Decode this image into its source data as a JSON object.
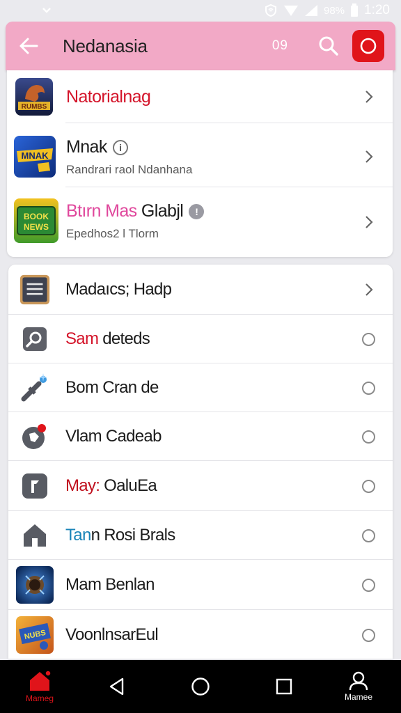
{
  "status_bar": {
    "battery": "98%",
    "time": "1:20"
  },
  "app_bar": {
    "title": "Nedanasia",
    "count": "09",
    "icons": [
      "back-arrow-icon",
      "search-icon",
      "record-icon"
    ]
  },
  "featured": [
    {
      "title": "Natorialnag",
      "subtitle": "",
      "title_color": "#d4142a",
      "badge": "",
      "icon": "game-icon-1"
    },
    {
      "title": "Mnak",
      "subtitle": "Randrari raol Ndanhana",
      "title_color": "#1c1c1c",
      "badge": "outline",
      "icon": "game-icon-2"
    },
    {
      "title": "Btırn Mas Glabjl",
      "subtitle": "Epedhos2 l Tlorm",
      "title_color": "#e0479c",
      "title_suffix_color": "#1c1c1c",
      "title_split": 9,
      "badge": "filled",
      "icon": "game-icon-3"
    }
  ],
  "list": [
    {
      "prefix": "",
      "label": "Madaıcs; Hadp",
      "prefix_color": "",
      "trailing": "chevron",
      "icon": "document-icon"
    },
    {
      "prefix": "Sam",
      "label": " deteds",
      "prefix_color": "#d4142a",
      "trailing": "radio",
      "icon": "magnifier-icon"
    },
    {
      "prefix": "",
      "label": "Bom Cran de",
      "prefix_color": "",
      "trailing": "radio",
      "icon": "wand-icon"
    },
    {
      "prefix": "",
      "label": "Vlam Cadeab",
      "prefix_color": "",
      "trailing": "radio",
      "icon": "shield-badge-icon"
    },
    {
      "prefix": "May:",
      "label": " OaluEa",
      "prefix_color": "#c0101e",
      "trailing": "radio",
      "icon": "flag-icon"
    },
    {
      "prefix": "Tan",
      "label": "n Rosi Brals",
      "prefix_color": "#1a84b8",
      "trailing": "radio",
      "icon": "home-icon"
    },
    {
      "prefix": "",
      "label": "Mam Benlan",
      "prefix_color": "",
      "trailing": "radio",
      "icon": "game-icon-4"
    },
    {
      "prefix": "",
      "label": "VoonlnsarEul",
      "prefix_color": "",
      "trailing": "radio",
      "icon": "game-icon-5"
    }
  ],
  "nav": {
    "home_label": "Mameg",
    "profile_label": "Mamee",
    "home_color": "#e0141a",
    "icons": [
      "home-nav-icon",
      "back-triangle-icon",
      "home-circle-icon",
      "recents-square-icon",
      "profile-icon"
    ]
  }
}
